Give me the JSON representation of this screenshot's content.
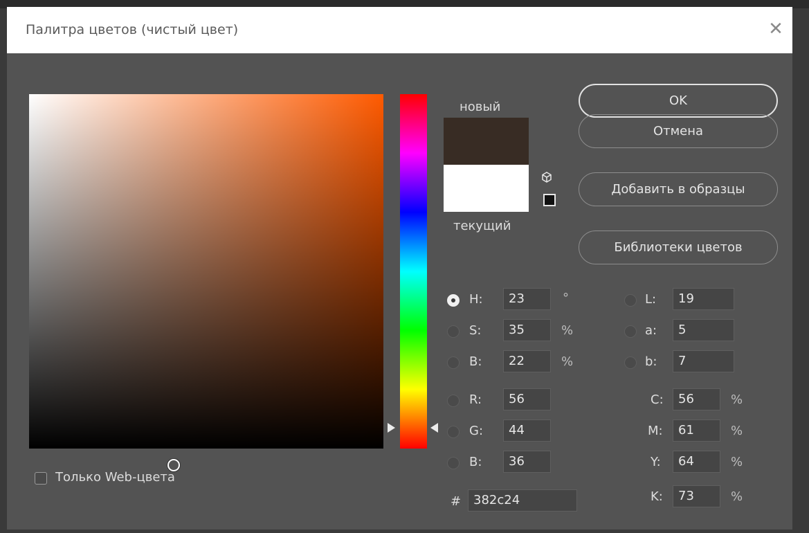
{
  "window": {
    "title": "Палитра цветов (чистый цвет)"
  },
  "preview": {
    "new_label": "новый",
    "current_label": "текущий",
    "new_color": "#382c24",
    "current_color": "#ffffff"
  },
  "buttons": {
    "ok": "OK",
    "cancel": "Отмена",
    "add_to_swatches": "Добавить в образцы",
    "color_libraries": "Библиотеки цветов"
  },
  "fields": {
    "H": {
      "label": "H:",
      "value": "23",
      "unit": "°"
    },
    "S": {
      "label": "S:",
      "value": "35",
      "unit": "%"
    },
    "Bv": {
      "label": "B:",
      "value": "22",
      "unit": "%"
    },
    "R": {
      "label": "R:",
      "value": "56"
    },
    "G": {
      "label": "G:",
      "value": "44"
    },
    "Bc": {
      "label": "B:",
      "value": "36"
    },
    "L": {
      "label": "L:",
      "value": "19"
    },
    "a": {
      "label": "a:",
      "value": "5"
    },
    "b": {
      "label": "b:",
      "value": "7"
    },
    "C": {
      "label": "C:",
      "value": "56",
      "unit": "%"
    },
    "M": {
      "label": "M:",
      "value": "61",
      "unit": "%"
    },
    "Y": {
      "label": "Y:",
      "value": "64",
      "unit": "%"
    },
    "K": {
      "label": "K:",
      "value": "73",
      "unit": "%"
    },
    "hex": {
      "label": "#",
      "value": "382c24"
    }
  },
  "web_only": {
    "label": "Только Web-цвета",
    "checked": false
  },
  "icons": {
    "close": "close-icon",
    "gamut_warning": "cube-icon",
    "web_safe": "square-icon"
  }
}
